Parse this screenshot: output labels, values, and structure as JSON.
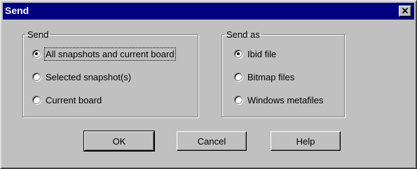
{
  "window": {
    "title": "Send",
    "close_glyph": "✕"
  },
  "send_group": {
    "legend": "Send",
    "options": [
      {
        "label": "All snapshots and current board",
        "selected": true
      },
      {
        "label": "Selected snapshot(s)",
        "selected": false
      },
      {
        "label": "Current board",
        "selected": false
      }
    ]
  },
  "send_as_group": {
    "legend": "Send as",
    "options": [
      {
        "label": "Ibid file",
        "selected": true
      },
      {
        "label": "Bitmap files",
        "selected": false
      },
      {
        "label": "Windows metafiles",
        "selected": false
      }
    ]
  },
  "buttons": {
    "ok": "OK",
    "cancel": "Cancel",
    "help": "Help"
  }
}
